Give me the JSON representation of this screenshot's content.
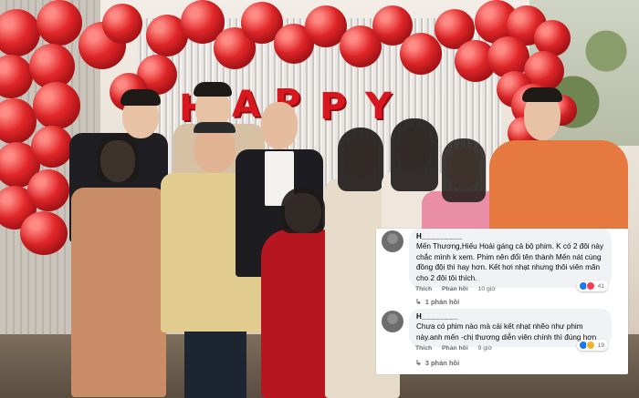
{
  "banner": {
    "letters": [
      "H",
      "A",
      "P",
      "P",
      "Y"
    ]
  },
  "comments": [
    {
      "author": "H_________",
      "text": "Mến Thương,Hiếu Hoài gáng cả bộ phim. K có 2 đôi này chắc mình k xem. Phim nên đổi tên thành Mến nát cùng đồng đội thì hay hơn. Kết hơi nhạt nhưng thôi viên mãn cho 2 đôi tôi thích.",
      "like_label": "Thích",
      "reply_label": "Phản hồi",
      "time": "10 giờ",
      "reaction_count": "41",
      "replies": "1 phản hồi"
    },
    {
      "author": "H________",
      "text": "Chưa có phim nào mà cái kết nhạt nhẽo như phim này.anh mến -chị thương diễn viên chính thì đúng hơn",
      "like_label": "Thích",
      "reply_label": "Phản hồi",
      "time": "9 giờ",
      "reaction_count": "19",
      "replies": "3 phản hồi"
    }
  ],
  "icons": {
    "avatar": "user-avatar-icon",
    "like": "like-reaction-icon",
    "love": "love-reaction-icon",
    "haha": "haha-reaction-icon",
    "reply": "reply-arrow-icon"
  },
  "colors": {
    "balloon": "#e3272a",
    "bubble": "#f0f2f5",
    "link_gray": "#65676b",
    "like_blue": "#1877f2"
  }
}
